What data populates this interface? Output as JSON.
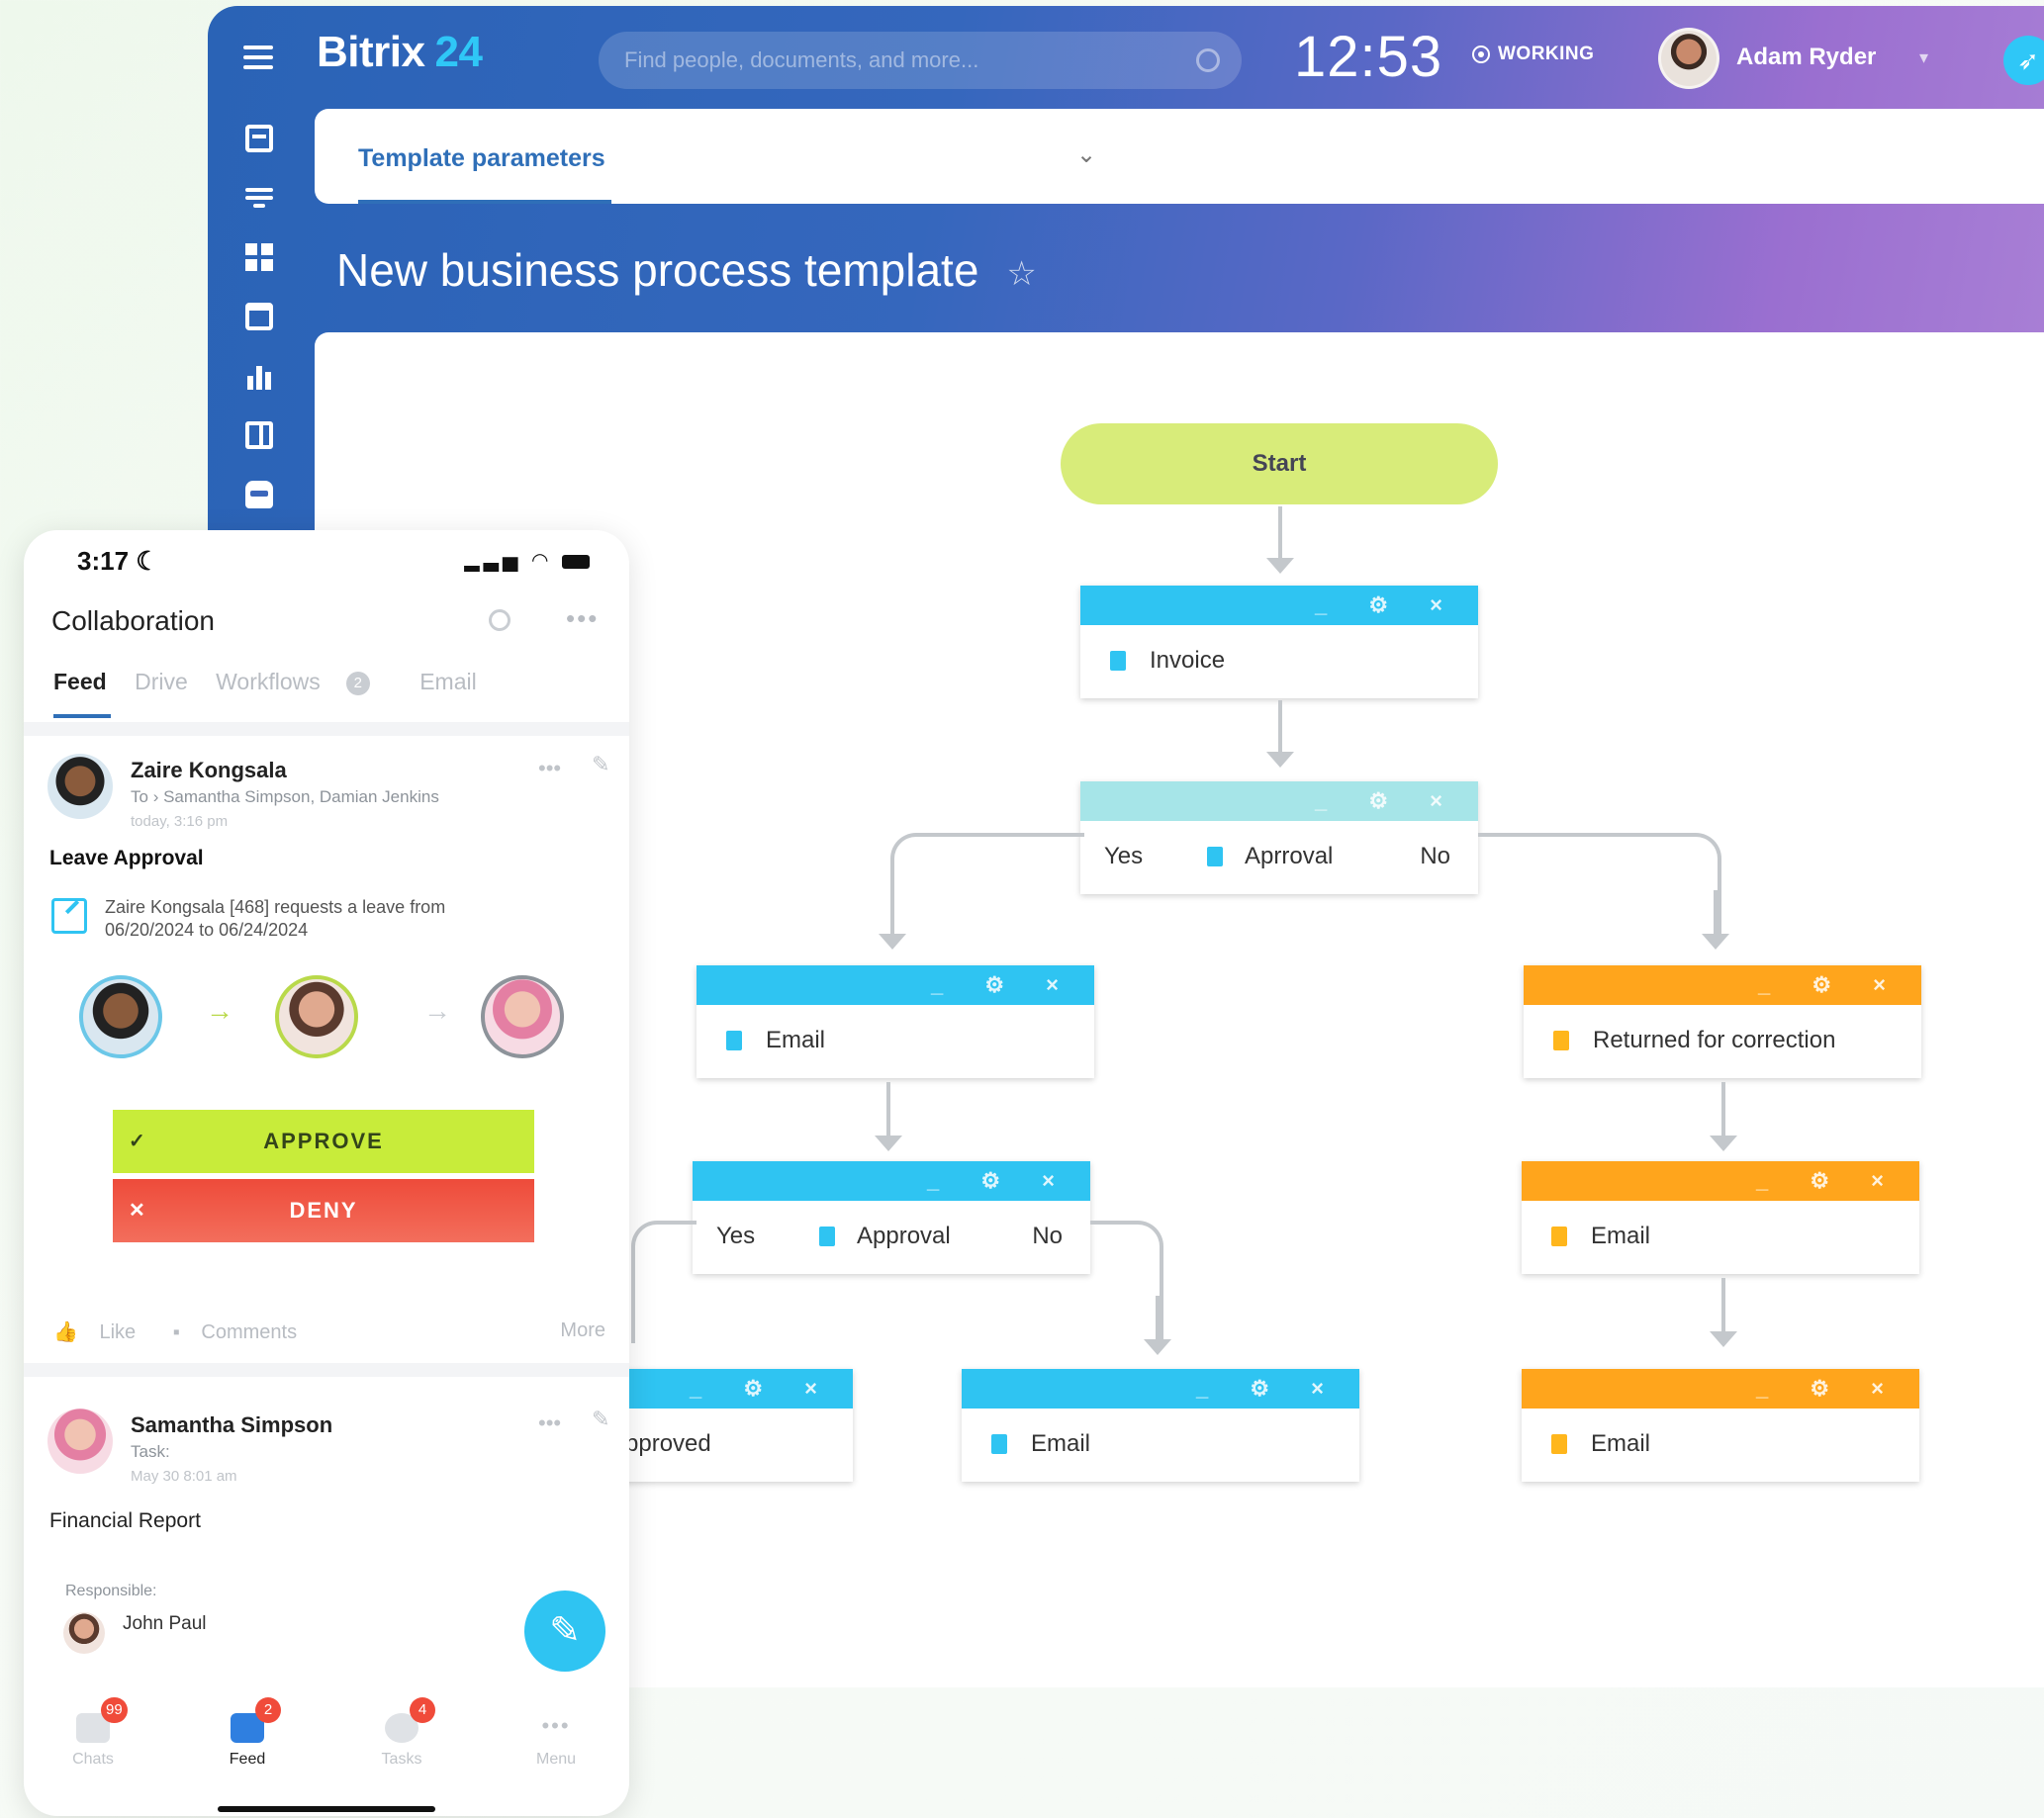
{
  "desktop": {
    "brand": {
      "name": "Bitrix",
      "num": "24"
    },
    "search_placeholder": "Find people, documents, and more...",
    "clock": "12:53",
    "status": "WORKING",
    "user": "Adam Ryder",
    "template_tab": "Template parameters",
    "page_title": "New business process template"
  },
  "flow": {
    "start": "Start",
    "invoice": "Invoice",
    "approval1": {
      "yes": "Yes",
      "label": "Aprroval",
      "no": "No"
    },
    "email_left": "Email",
    "returned": "Returned for correction",
    "approval2": {
      "yes": "Yes",
      "label": "Approval",
      "no": "No"
    },
    "email_right": "Email",
    "approved": "pproved",
    "email_mid": "Email",
    "email_right2": "Email",
    "block_controls": "_ ⚙ ×"
  },
  "phone": {
    "time": "3:17",
    "title": "Collaboration",
    "tabs": {
      "feed": "Feed",
      "drive": "Drive",
      "workflows": "Workflows",
      "workflows_count": "2",
      "email": "Email"
    },
    "post1": {
      "author": "Zaire Kongsala",
      "to_prefix": "To",
      "to": "Samantha Simpson, Damian Jenkins",
      "time": "today, 3:16 pm",
      "heading": "Leave Approval",
      "text1": "Zaire Kongsala [468] requests a leave from",
      "text2": "06/20/2024 to 06/24/2024",
      "approve": "APPROVE",
      "deny": "DENY",
      "like": "Like",
      "comments": "Comments",
      "more": "More"
    },
    "post2": {
      "author": "Samantha Simpson",
      "sub": "Task:",
      "time": "May 30 8:01 am",
      "heading": "Financial Report",
      "responsible_label": "Responsible:",
      "responsible": "John Paul"
    },
    "nav": {
      "chats": "Chats",
      "chats_badge": "99",
      "feed": "Feed",
      "feed_badge": "2",
      "tasks": "Tasks",
      "tasks_badge": "4",
      "menu": "Menu"
    }
  }
}
